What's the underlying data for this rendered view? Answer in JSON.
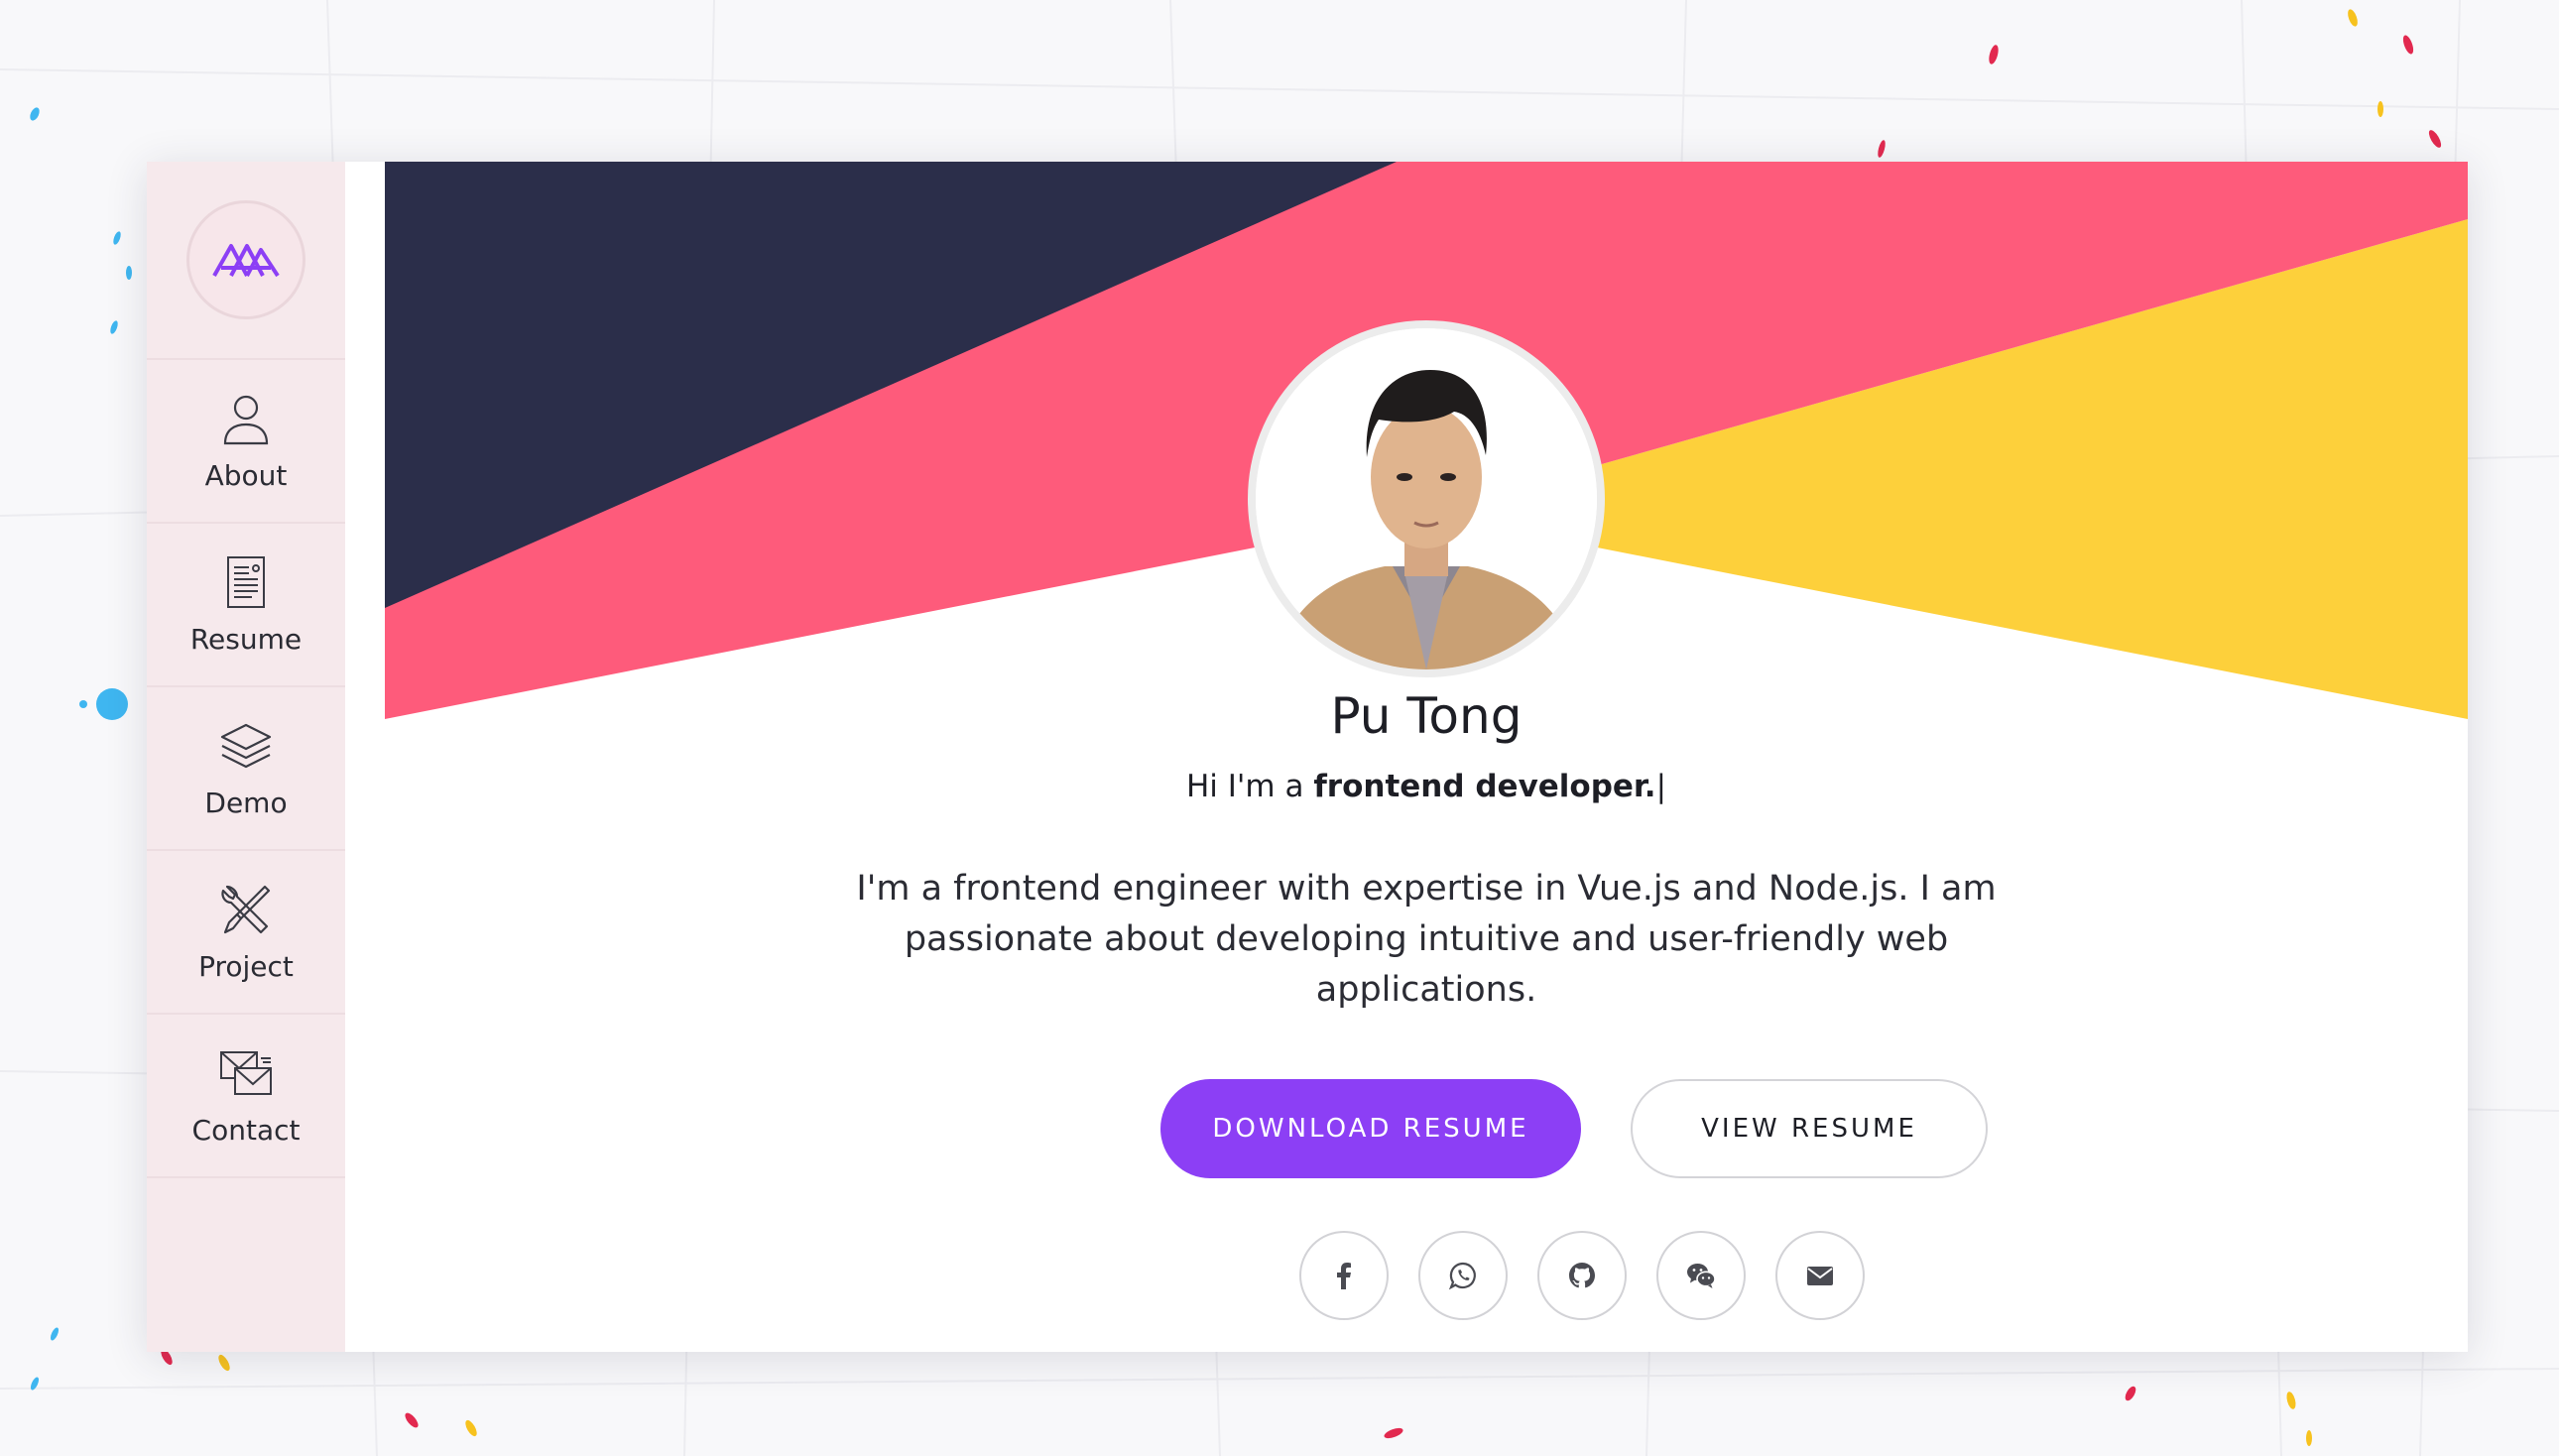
{
  "theme": {
    "accent": "#8c3ff5",
    "banner_navy": "#2b2e4a",
    "banner_pink": "#fe5b7b",
    "banner_yellow": "#fdd03b",
    "sidebar_bg": "#f6e9ec"
  },
  "sidebar": {
    "logo_icon": "mountain-logo-icon",
    "items": [
      {
        "label": "About",
        "icon": "user-icon"
      },
      {
        "label": "Resume",
        "icon": "document-icon"
      },
      {
        "label": "Demo",
        "icon": "layers-icon"
      },
      {
        "label": "Project",
        "icon": "tools-icon"
      },
      {
        "label": "Contact",
        "icon": "envelope-icon"
      }
    ]
  },
  "profile": {
    "name": "Pu Tong",
    "tagline_prefix": "Hi I'm a",
    "tagline_role": "frontend developer.",
    "tagline_cursor": "|",
    "bio": "I'm a frontend engineer with expertise in Vue.js and Node.js. I am passionate about developing intuitive and user-friendly web applications."
  },
  "actions": {
    "download_label": "DOWNLOAD RESUME",
    "view_label": "VIEW RESUME"
  },
  "social": [
    {
      "name": "facebook",
      "icon": "facebook-icon"
    },
    {
      "name": "whatsapp",
      "icon": "whatsapp-icon"
    },
    {
      "name": "github",
      "icon": "github-icon"
    },
    {
      "name": "wechat",
      "icon": "wechat-icon"
    },
    {
      "name": "email",
      "icon": "envelope-icon"
    }
  ]
}
